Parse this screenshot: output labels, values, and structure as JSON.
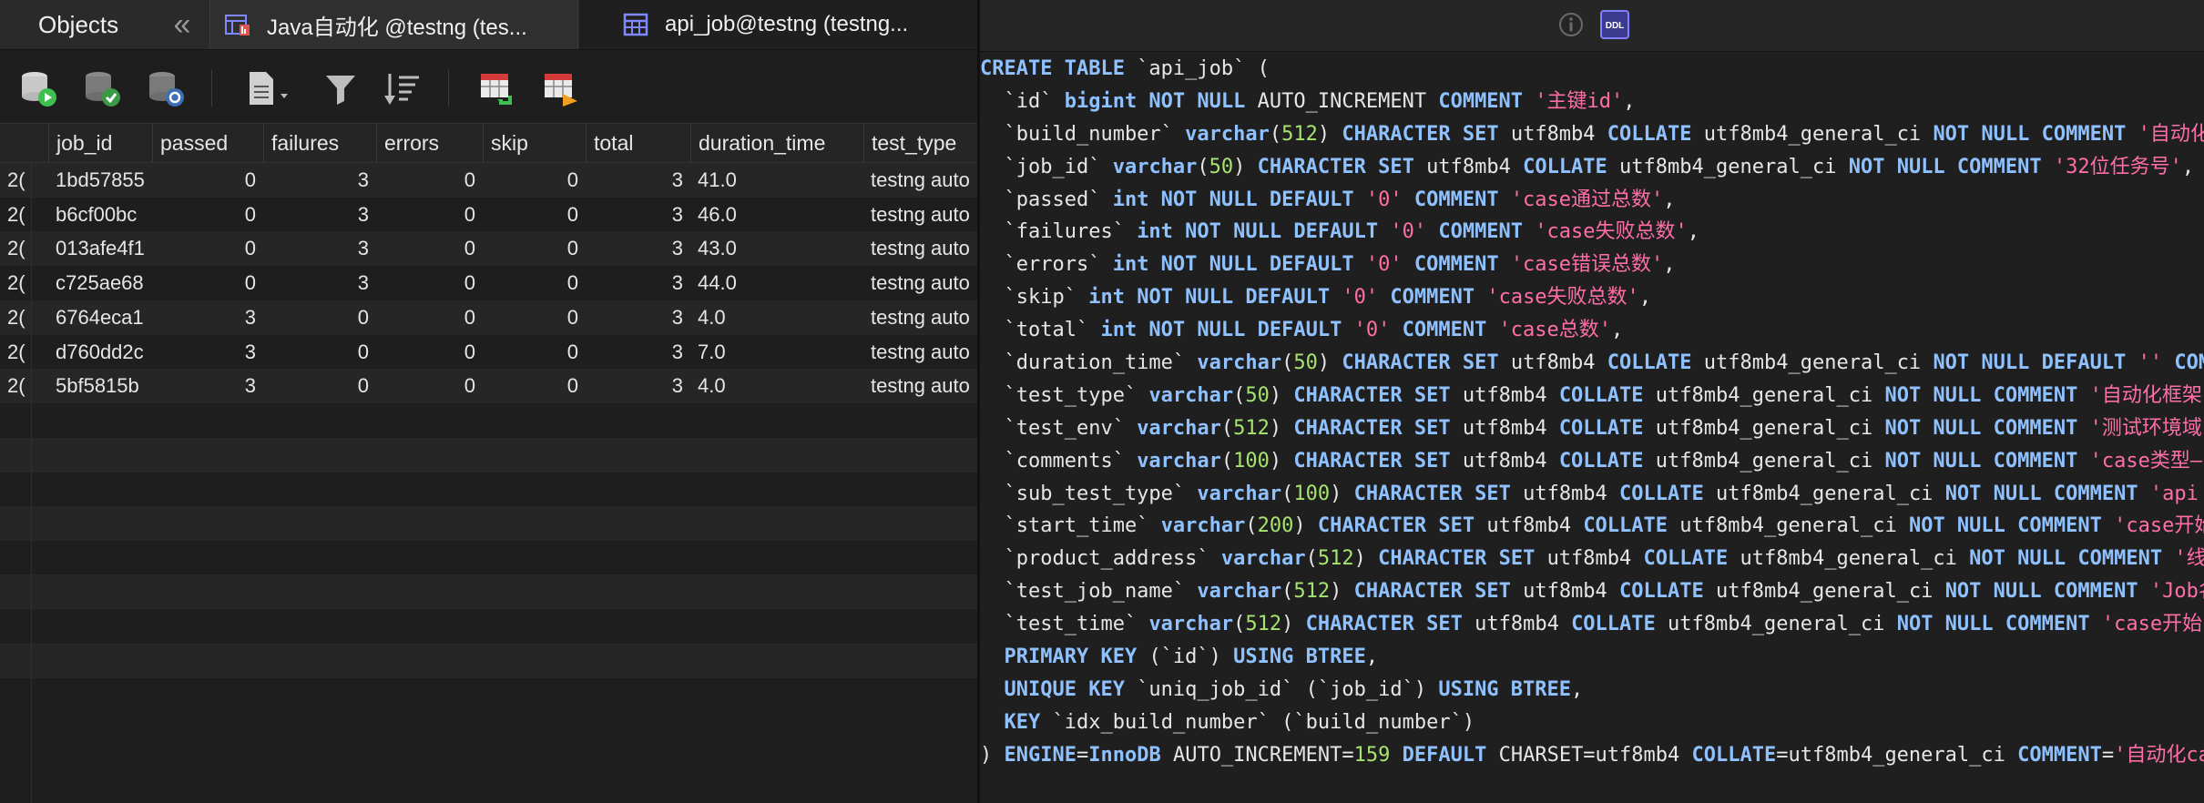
{
  "tabs": {
    "objects": "Objects",
    "collapse": "«",
    "java_tab": "Java自动化 @testng (tes...",
    "api_tab": "api_job@testng (testng..."
  },
  "toolbar": {
    "icons": [
      "db-run-icon",
      "db-check-icon",
      "db-refresh-icon",
      "document-icon",
      "filter-icon",
      "sort-icon",
      "table-import-icon",
      "table-export-icon"
    ]
  },
  "grid": {
    "columns": [
      "job_id",
      "passed",
      "failures",
      "errors",
      "skip",
      "total",
      "duration_time",
      "test_type"
    ],
    "rows": [
      {
        "gutter": "2(",
        "job_id": "1bd57855",
        "passed": "0",
        "failures": "3",
        "errors": "0",
        "skip": "0",
        "total": "3",
        "duration_time": "41.0",
        "test_type": "testng auto"
      },
      {
        "gutter": "2(",
        "job_id": "b6cf00bc",
        "passed": "0",
        "failures": "3",
        "errors": "0",
        "skip": "0",
        "total": "3",
        "duration_time": "46.0",
        "test_type": "testng auto"
      },
      {
        "gutter": "2(",
        "job_id": "013afe4f1",
        "passed": "0",
        "failures": "3",
        "errors": "0",
        "skip": "0",
        "total": "3",
        "duration_time": "43.0",
        "test_type": "testng auto"
      },
      {
        "gutter": "2(",
        "job_id": "c725ae68",
        "passed": "0",
        "failures": "3",
        "errors": "0",
        "skip": "0",
        "total": "3",
        "duration_time": "44.0",
        "test_type": "testng auto"
      },
      {
        "gutter": "2(",
        "job_id": "6764eca1",
        "passed": "3",
        "failures": "0",
        "errors": "0",
        "skip": "0",
        "total": "3",
        "duration_time": "4.0",
        "test_type": "testng auto"
      },
      {
        "gutter": "2(",
        "job_id": "d760dd2c",
        "passed": "3",
        "failures": "0",
        "errors": "0",
        "skip": "0",
        "total": "3",
        "duration_time": "7.0",
        "test_type": "testng auto"
      },
      {
        "gutter": "2(",
        "job_id": "5bf5815b",
        "passed": "3",
        "failures": "0",
        "errors": "0",
        "skip": "0",
        "total": "3",
        "duration_time": "4.0",
        "test_type": "testng auto"
      }
    ]
  },
  "ddl": {
    "lines": [
      [
        [
          "kw",
          "CREATE TABLE "
        ],
        [
          "plain",
          "`api_job` ("
        ]
      ],
      [
        [
          "plain",
          "  `id` "
        ],
        [
          "kw",
          "bigint NOT NULL "
        ],
        [
          "plain",
          "AUTO_INCREMENT "
        ],
        [
          "kw",
          "COMMENT "
        ],
        [
          "str",
          "'主键id'"
        ],
        [
          "plain",
          ","
        ]
      ],
      [
        [
          "plain",
          "  `build_number` "
        ],
        [
          "kw",
          "varchar"
        ],
        [
          "plain",
          "("
        ],
        [
          "numlit",
          "512"
        ],
        [
          "plain",
          ") "
        ],
        [
          "kw",
          "CHARACTER SET "
        ],
        [
          "plain",
          "utf8mb4 "
        ],
        [
          "kw",
          "COLLATE "
        ],
        [
          "plain",
          "utf8mb4_general_ci "
        ],
        [
          "kw",
          "NOT NULL COMMENT "
        ],
        [
          "str",
          "'自动化"
        ]
      ],
      [
        [
          "plain",
          "  `job_id` "
        ],
        [
          "kw",
          "varchar"
        ],
        [
          "plain",
          "("
        ],
        [
          "numlit",
          "50"
        ],
        [
          "plain",
          ") "
        ],
        [
          "kw",
          "CHARACTER SET "
        ],
        [
          "plain",
          "utf8mb4 "
        ],
        [
          "kw",
          "COLLATE "
        ],
        [
          "plain",
          "utf8mb4_general_ci "
        ],
        [
          "kw",
          "NOT NULL COMMENT "
        ],
        [
          "str",
          "'32位任务号'"
        ],
        [
          "plain",
          ","
        ]
      ],
      [
        [
          "plain",
          "  `passed` "
        ],
        [
          "kw",
          "int NOT NULL DEFAULT "
        ],
        [
          "str",
          "'0' "
        ],
        [
          "kw",
          "COMMENT "
        ],
        [
          "str",
          "'case通过总数'"
        ],
        [
          "plain",
          ","
        ]
      ],
      [
        [
          "plain",
          "  `failures` "
        ],
        [
          "kw",
          "int NOT NULL DEFAULT "
        ],
        [
          "str",
          "'0' "
        ],
        [
          "kw",
          "COMMENT "
        ],
        [
          "str",
          "'case失败总数'"
        ],
        [
          "plain",
          ","
        ]
      ],
      [
        [
          "plain",
          "  `errors` "
        ],
        [
          "kw",
          "int NOT NULL DEFAULT "
        ],
        [
          "str",
          "'0' "
        ],
        [
          "kw",
          "COMMENT "
        ],
        [
          "str",
          "'case错误总数'"
        ],
        [
          "plain",
          ","
        ]
      ],
      [
        [
          "plain",
          "  `skip` "
        ],
        [
          "kw",
          "int NOT NULL DEFAULT "
        ],
        [
          "str",
          "'0' "
        ],
        [
          "kw",
          "COMMENT "
        ],
        [
          "str",
          "'case失败总数'"
        ],
        [
          "plain",
          ","
        ]
      ],
      [
        [
          "plain",
          "  `total` "
        ],
        [
          "kw",
          "int NOT NULL DEFAULT "
        ],
        [
          "str",
          "'0' "
        ],
        [
          "kw",
          "COMMENT "
        ],
        [
          "str",
          "'case总数'"
        ],
        [
          "plain",
          ","
        ]
      ],
      [
        [
          "plain",
          "  `duration_time` "
        ],
        [
          "kw",
          "varchar"
        ],
        [
          "plain",
          "("
        ],
        [
          "numlit",
          "50"
        ],
        [
          "plain",
          ") "
        ],
        [
          "kw",
          "CHARACTER SET "
        ],
        [
          "plain",
          "utf8mb4 "
        ],
        [
          "kw",
          "COLLATE "
        ],
        [
          "plain",
          "utf8mb4_general_ci "
        ],
        [
          "kw",
          "NOT NULL DEFAULT "
        ],
        [
          "str",
          "'' "
        ],
        [
          "kw",
          "COM"
        ]
      ],
      [
        [
          "plain",
          "  `test_type` "
        ],
        [
          "kw",
          "varchar"
        ],
        [
          "plain",
          "("
        ],
        [
          "numlit",
          "50"
        ],
        [
          "plain",
          ") "
        ],
        [
          "kw",
          "CHARACTER SET "
        ],
        [
          "plain",
          "utf8mb4 "
        ],
        [
          "kw",
          "COLLATE "
        ],
        [
          "plain",
          "utf8mb4_general_ci "
        ],
        [
          "kw",
          "NOT NULL COMMENT "
        ],
        [
          "str",
          "'自动化框架"
        ]
      ],
      [
        [
          "plain",
          "  `test_env` "
        ],
        [
          "kw",
          "varchar"
        ],
        [
          "plain",
          "("
        ],
        [
          "numlit",
          "512"
        ],
        [
          "plain",
          ") "
        ],
        [
          "kw",
          "CHARACTER SET "
        ],
        [
          "plain",
          "utf8mb4 "
        ],
        [
          "kw",
          "COLLATE "
        ],
        [
          "plain",
          "utf8mb4_general_ci "
        ],
        [
          "kw",
          "NOT NULL COMMENT "
        ],
        [
          "str",
          "'测试环境域"
        ]
      ],
      [
        [
          "plain",
          "  `comments` "
        ],
        [
          "kw",
          "varchar"
        ],
        [
          "plain",
          "("
        ],
        [
          "numlit",
          "100"
        ],
        [
          "plain",
          ") "
        ],
        [
          "kw",
          "CHARACTER SET "
        ],
        [
          "plain",
          "utf8mb4 "
        ],
        [
          "kw",
          "COLLATE "
        ],
        [
          "plain",
          "utf8mb4_general_ci "
        ],
        [
          "kw",
          "NOT NULL COMMENT "
        ],
        [
          "str",
          "'case类型—"
        ]
      ],
      [
        [
          "plain",
          "  `sub_test_type` "
        ],
        [
          "kw",
          "varchar"
        ],
        [
          "plain",
          "("
        ],
        [
          "numlit",
          "100"
        ],
        [
          "plain",
          ") "
        ],
        [
          "kw",
          "CHARACTER SET "
        ],
        [
          "plain",
          "utf8mb4 "
        ],
        [
          "kw",
          "COLLATE "
        ],
        [
          "plain",
          "utf8mb4_general_ci "
        ],
        [
          "kw",
          "NOT NULL COMMENT "
        ],
        [
          "str",
          "'api"
        ]
      ],
      [
        [
          "plain",
          "  `start_time` "
        ],
        [
          "kw",
          "varchar"
        ],
        [
          "plain",
          "("
        ],
        [
          "numlit",
          "200"
        ],
        [
          "plain",
          ") "
        ],
        [
          "kw",
          "CHARACTER SET "
        ],
        [
          "plain",
          "utf8mb4 "
        ],
        [
          "kw",
          "COLLATE "
        ],
        [
          "plain",
          "utf8mb4_general_ci "
        ],
        [
          "kw",
          "NOT NULL COMMENT "
        ],
        [
          "str",
          "'case开始"
        ]
      ],
      [
        [
          "plain",
          "  `product_address` "
        ],
        [
          "kw",
          "varchar"
        ],
        [
          "plain",
          "("
        ],
        [
          "numlit",
          "512"
        ],
        [
          "plain",
          ") "
        ],
        [
          "kw",
          "CHARACTER SET "
        ],
        [
          "plain",
          "utf8mb4 "
        ],
        [
          "kw",
          "COLLATE "
        ],
        [
          "plain",
          "utf8mb4_general_ci "
        ],
        [
          "kw",
          "NOT NULL COMMENT "
        ],
        [
          "str",
          "'线"
        ]
      ],
      [
        [
          "plain",
          "  `test_job_name` "
        ],
        [
          "kw",
          "varchar"
        ],
        [
          "plain",
          "("
        ],
        [
          "numlit",
          "512"
        ],
        [
          "plain",
          ") "
        ],
        [
          "kw",
          "CHARACTER SET "
        ],
        [
          "plain",
          "utf8mb4 "
        ],
        [
          "kw",
          "COLLATE "
        ],
        [
          "plain",
          "utf8mb4_general_ci "
        ],
        [
          "kw",
          "NOT NULL COMMENT "
        ],
        [
          "str",
          "'Job名"
        ]
      ],
      [
        [
          "plain",
          "  `test_time` "
        ],
        [
          "kw",
          "varchar"
        ],
        [
          "plain",
          "("
        ],
        [
          "numlit",
          "512"
        ],
        [
          "plain",
          ") "
        ],
        [
          "kw",
          "CHARACTER SET "
        ],
        [
          "plain",
          "utf8mb4 "
        ],
        [
          "kw",
          "COLLATE "
        ],
        [
          "plain",
          "utf8mb4_general_ci "
        ],
        [
          "kw",
          "NOT NULL COMMENT "
        ],
        [
          "str",
          "'case开始"
        ]
      ],
      [
        [
          "kw",
          "  PRIMARY KEY "
        ],
        [
          "plain",
          "(`id`) "
        ],
        [
          "kw",
          "USING BTREE"
        ],
        [
          "plain",
          ","
        ]
      ],
      [
        [
          "kw",
          "  UNIQUE KEY "
        ],
        [
          "plain",
          "`uniq_job_id` (`job_id`) "
        ],
        [
          "kw",
          "USING BTREE"
        ],
        [
          "plain",
          ","
        ]
      ],
      [
        [
          "kw",
          "  KEY "
        ],
        [
          "plain",
          "`idx_build_number` (`build_number`)"
        ]
      ],
      [
        [
          "plain",
          ") "
        ],
        [
          "kw",
          "ENGINE"
        ],
        [
          "plain",
          "="
        ],
        [
          "kw",
          "InnoDB "
        ],
        [
          "plain",
          "AUTO_INCREMENT="
        ],
        [
          "numlit",
          "159 "
        ],
        [
          "kw",
          "DEFAULT "
        ],
        [
          "plain",
          "CHARSET=utf8mb4 "
        ],
        [
          "kw",
          "COLLATE"
        ],
        [
          "plain",
          "=utf8mb4_general_ci "
        ],
        [
          "kw",
          "COMMENT"
        ],
        [
          "plain",
          "="
        ],
        [
          "str",
          "'自动化ca"
        ]
      ]
    ]
  }
}
